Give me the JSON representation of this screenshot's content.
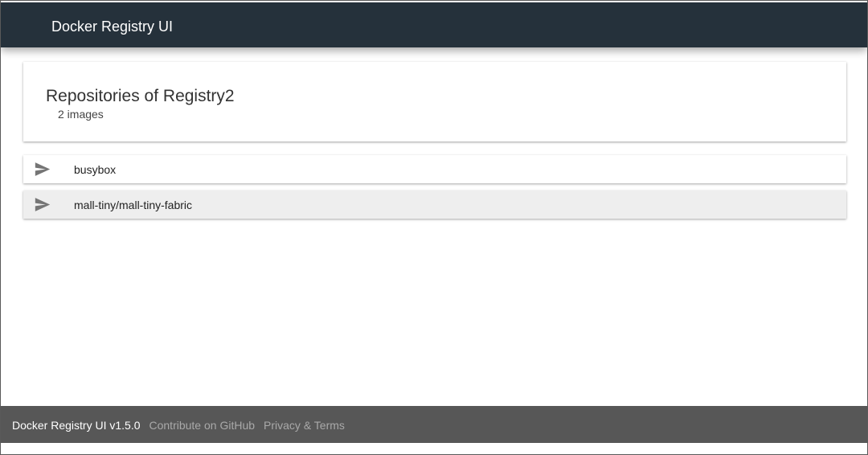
{
  "header": {
    "title": "Docker Registry UI"
  },
  "catalog": {
    "title": "Repositories of Registry2",
    "subtitle": "2 images",
    "repositories": [
      {
        "name": "busybox",
        "icon": "send-icon",
        "highlighted": false
      },
      {
        "name": "mall-tiny/mall-tiny-fabric",
        "icon": "send-icon",
        "highlighted": true
      }
    ]
  },
  "footer": {
    "brand": "Docker Registry UI v1.5.0",
    "links": [
      {
        "label": "Contribute on GitHub"
      },
      {
        "label": "Privacy & Terms"
      }
    ]
  },
  "colors": {
    "header_bg": "#25313b",
    "footer_bg": "#575757",
    "icon": "#757575",
    "hover_bg": "#eeeeee",
    "footer_link": "#a9a9a9"
  }
}
